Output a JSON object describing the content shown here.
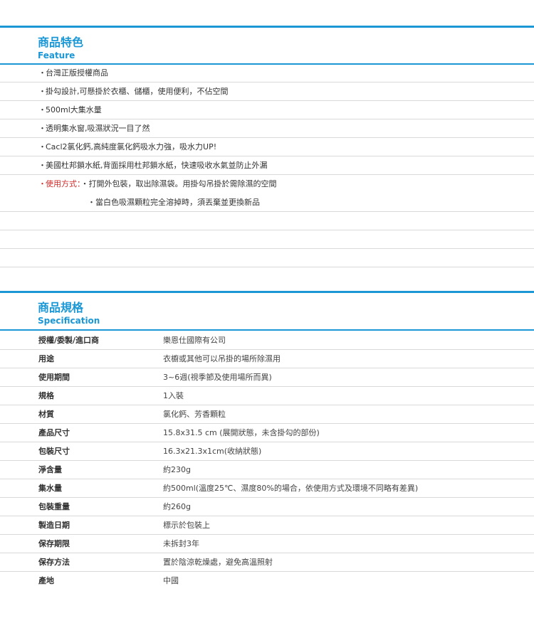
{
  "feature": {
    "title_zh": "商品特色",
    "title_en": "Feature",
    "items": [
      "台灣正版授權商品",
      "掛勾設計,可懸掛於衣櫃、儲櫃，使用便利，不佔空間",
      "500ml大集水量",
      "透明集水窗,吸濕狀況一目了然",
      "Cacl2氯化鈣,高純度氯化鈣吸水力強，吸水力UP!",
      "美國杜邦鎖水紙,背面採用杜邦鎖水紙，快速吸收水氣並防止外漏"
    ],
    "usage_label": "使用方式：",
    "usage_steps": [
      "打開外包裝，取出除濕袋。用掛勾吊掛於需除濕的空間",
      "當白色吸濕顆粒完全溶掉時，須丟棄並更換新品"
    ],
    "bullet": "・"
  },
  "spec": {
    "title_zh": "商品規格",
    "title_en": "Specification",
    "rows": [
      {
        "label": "授權/委製/進口商",
        "value": "樂恩仕國際有公司"
      },
      {
        "label": "用途",
        "value": "衣櫥或其他可以吊掛的場所除濕用"
      },
      {
        "label": "使用期間",
        "value": "3~6週(視季節及使用場所而異)"
      },
      {
        "label": "規格",
        "value": "1入裝"
      },
      {
        "label": "材質",
        "value": "氯化鈣、芳香顆粒"
      },
      {
        "label": "產品尺寸",
        "value": "15.8x31.5 cm (展開狀態，未含掛勾的部份)"
      },
      {
        "label": "包裝尺寸",
        "value": "16.3x21.3x1cm(收納狀態)"
      },
      {
        "label": "淨含量",
        "value": "約230g"
      },
      {
        "label": "集水量",
        "value": "約500ml(溫度25℃、濕度80%的場合，依使用方式及環境不同略有差異)"
      },
      {
        "label": "包裝重量",
        "value": "約260g"
      },
      {
        "label": "製造日期",
        "value": "標示於包裝上"
      },
      {
        "label": "保存期限",
        "value": "未拆封3年"
      },
      {
        "label": "保存方法",
        "value": "置於陰涼乾燥處，避免高溫照射"
      },
      {
        "label": "產地",
        "value": "中國"
      }
    ]
  },
  "colors": {
    "accent": "#1a97d4",
    "usage_label": "#d22b2b",
    "divider": "#d9d9d9"
  }
}
